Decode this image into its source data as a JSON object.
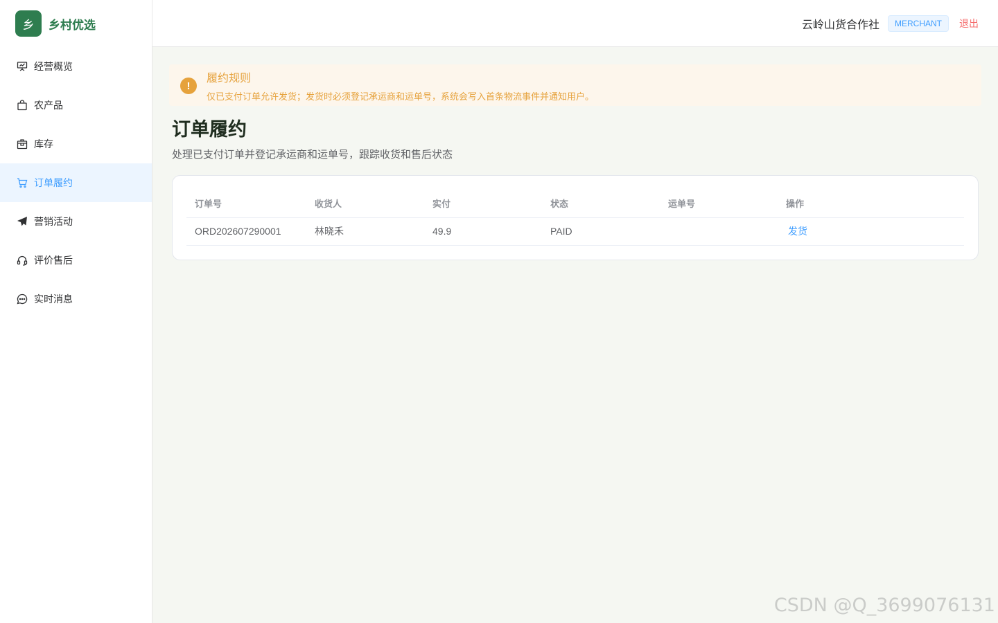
{
  "brand": {
    "logo_char": "乡",
    "name": "乡村优选",
    "color": "#2e7d4f"
  },
  "sidebar": {
    "items": [
      {
        "label": "经营概览",
        "icon": "presentation-chart-icon"
      },
      {
        "label": "农产品",
        "icon": "shopping-bag-icon"
      },
      {
        "label": "库存",
        "icon": "box-icon"
      },
      {
        "label": "订单履约",
        "icon": "cart-icon",
        "active": true
      },
      {
        "label": "营销活动",
        "icon": "send-icon"
      },
      {
        "label": "评价售后",
        "icon": "headset-icon"
      },
      {
        "label": "实时消息",
        "icon": "chat-bubble-icon"
      }
    ]
  },
  "header": {
    "org_name": "云岭山货合作社",
    "role": "MERCHANT",
    "logout": "退出"
  },
  "alert": {
    "icon": "warning-icon",
    "title": "履约规则",
    "description": "仅已支付订单允许发货；发货时必须登记承运商和运单号，系统会写入首条物流事件并通知用户。"
  },
  "page": {
    "title": "订单履约",
    "subtitle": "处理已支付订单并登记承运商和运单号，跟踪收货和售后状态"
  },
  "table": {
    "headers": [
      "订单号",
      "收货人",
      "实付",
      "状态",
      "运单号",
      "操作"
    ],
    "rows": [
      {
        "order_no": "ORD202607290001",
        "receiver": "林晓禾",
        "paid": "49.9",
        "status": "PAID",
        "tracking_no": "",
        "action": "发货"
      }
    ]
  },
  "watermark": "CSDN @Q_3699076131",
  "colors": {
    "primary": "#409eff",
    "warning": "#e6a23c",
    "danger": "#f56c6c",
    "background": "#f5f7f2"
  }
}
